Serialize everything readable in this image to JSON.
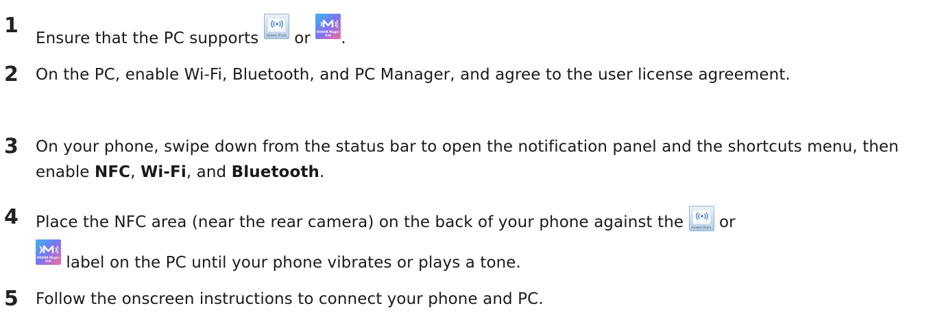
{
  "steps": [
    {
      "num": "1",
      "text_a": "Ensure that the PC supports ",
      "text_b": " or ",
      "text_c": "."
    },
    {
      "num": "2",
      "text": "On the PC, enable Wi-Fi, Bluetooth, and PC Manager, and agree to the user license agreement."
    },
    {
      "num": "3",
      "text_a": "On your phone, swipe down from the status bar to open the notification panel and the shortcuts menu, then enable ",
      "nfc": "NFC",
      "sep1": ", ",
      "wifi": "Wi-Fi",
      "sep2": ", and ",
      "bt": "Bluetooth",
      "end": "."
    },
    {
      "num": "4",
      "text_a": "Place the NFC area (near the rear camera) on the back of your phone against the ",
      "text_b": " or",
      "text_c": " label on the PC until your phone vibrates or plays a tone."
    },
    {
      "num": "5",
      "text": "Follow the onscreen instructions to connect your phone and PC."
    }
  ],
  "labels": {
    "huawei_share": "Huawei Share",
    "honor_magic_link": "HONOR Magic-link"
  },
  "colors": {
    "text": "#1a1a1a",
    "huawei_share_frame": "#8fb1d3",
    "magic_link_gradient": [
      "#3ab4f2",
      "#7b73f0",
      "#f36fa0"
    ]
  }
}
